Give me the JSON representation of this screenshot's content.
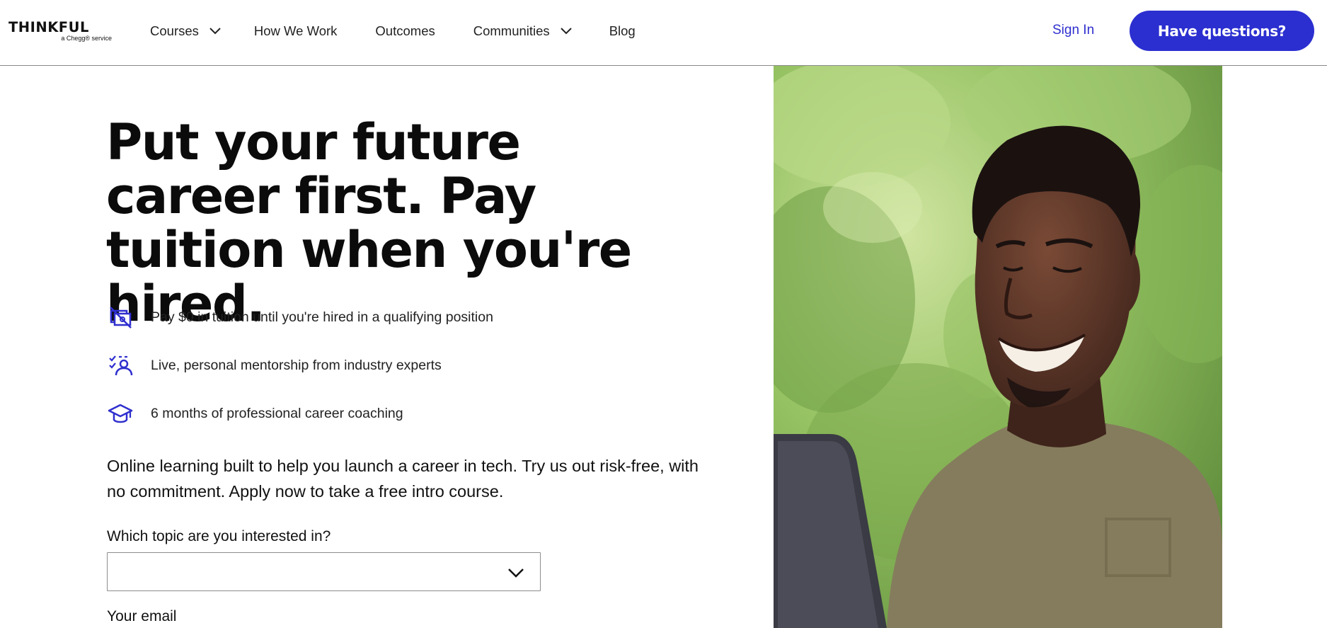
{
  "header": {
    "logo": {
      "wordmark": "THINKFUL",
      "sub": "a Chegg® service"
    },
    "nav": [
      {
        "label": "Courses",
        "has_dropdown": true
      },
      {
        "label": "How We Work",
        "has_dropdown": false
      },
      {
        "label": "Outcomes",
        "has_dropdown": false
      },
      {
        "label": "Communities",
        "has_dropdown": true
      },
      {
        "label": "Blog",
        "has_dropdown": false
      }
    ],
    "sign_in": "Sign In",
    "cta": "Have questions?"
  },
  "hero": {
    "title": "Put your future career first. Pay tuition when you're hired.",
    "features": [
      {
        "icon": "no-tuition-icon",
        "text": "Pay $0 in tuition until you're hired in a qualifying position"
      },
      {
        "icon": "mentor-icon",
        "text": "Live, personal mentorship from industry experts"
      },
      {
        "icon": "graduation-cap-icon",
        "text": "6 months of professional career coaching"
      }
    ],
    "blurb": "Online learning built to help you launch a career in tech. Try us out risk-free, with no commitment. Apply now to take a free intro course.",
    "form": {
      "topic_label": "Which topic are you interested in?",
      "topic_value": "",
      "email_label": "Your email"
    },
    "image": {
      "subject": "smiling-student-photo"
    }
  },
  "colors": {
    "accent": "#2b2fd0",
    "link": "#2f2fcf",
    "icon": "#2f2fcf",
    "text": "#111111",
    "divider": "#8a8a8a"
  }
}
